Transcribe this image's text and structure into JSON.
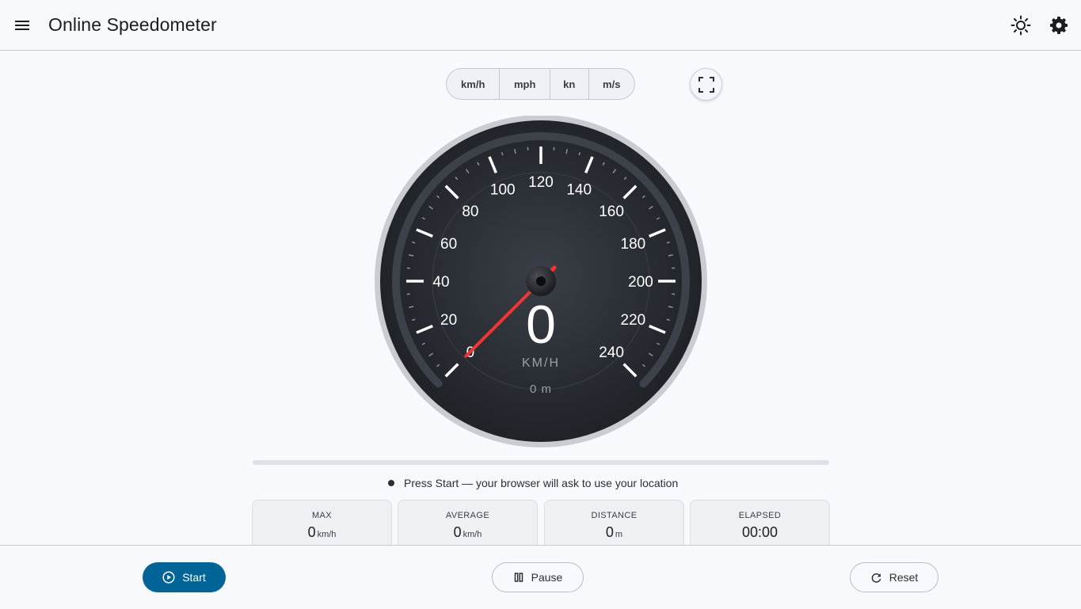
{
  "app": {
    "title": "Online Speedometer"
  },
  "units": [
    {
      "label": "km/h",
      "active": true
    },
    {
      "label": "mph",
      "active": false
    },
    {
      "label": "kn",
      "active": false
    },
    {
      "label": "m/s",
      "active": false
    }
  ],
  "gauge": {
    "speed": "0",
    "unit_label": "KM/H",
    "odometer": "0 m",
    "needle_value": 0,
    "min": 0,
    "max": 240,
    "major_ticks": [
      0,
      20,
      40,
      60,
      80,
      100,
      120,
      140,
      160,
      180,
      200,
      220,
      240
    ],
    "needle_color": "#ff3030"
  },
  "progress": {
    "value": 0
  },
  "status": {
    "text": "Press Start — your browser will ask to use your location"
  },
  "stats": {
    "max": {
      "label": "MAX",
      "value": "0",
      "unit": "km/h"
    },
    "average": {
      "label": "AVERAGE",
      "value": "0",
      "unit": "km/h"
    },
    "distance": {
      "label": "DISTANCE",
      "value": "0",
      "unit": "m"
    },
    "elapsed": {
      "label": "ELAPSED",
      "value": "00:00"
    }
  },
  "controls": {
    "start_label": "Start",
    "pause_label": "Pause",
    "reset_label": "Reset"
  },
  "icons": {
    "menu": "menu-icon",
    "theme": "sun-icon",
    "settings": "gear-icon",
    "fullscreen": "fullscreen-icon",
    "start": "play-circle-icon",
    "pause": "pause-icon",
    "reset": "refresh-icon"
  },
  "colors": {
    "accent": "#006496",
    "needle": "#ff3030"
  }
}
